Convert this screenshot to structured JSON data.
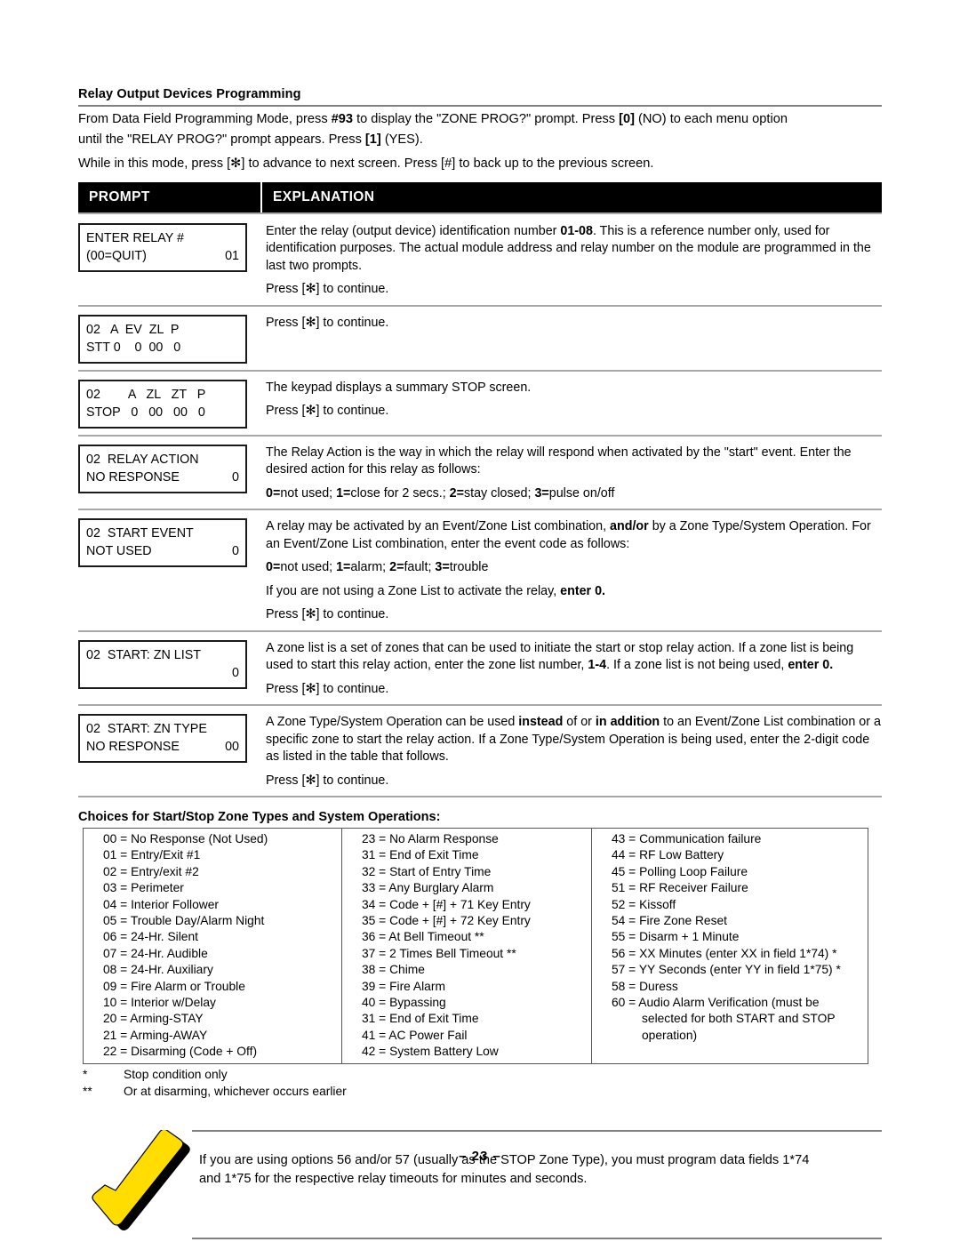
{
  "section": {
    "title": "Relay Output Devices Programming",
    "intro_line1": "From Data Field Programming Mode, press #93 to display the \"ZONE PROG?\" prompt.  Press [0] (NO) to each menu option",
    "intro_line2": "until the \"RELAY PROG?\" prompt appears. Press [1] (YES).",
    "intro_line3": "While in this mode, press [✻] to advance to next screen. Press [#] to back up to the previous screen."
  },
  "table_header": {
    "prompt": "PROMPT",
    "explanation": "EXPLANATION"
  },
  "rows": [
    {
      "keypad": {
        "line1_left": "ENTER RELAY #",
        "line1_right": "",
        "line2_left": "(00=QUIT)",
        "line2_right": "01"
      },
      "explanation": [
        "Enter the relay (output device) identification number 01-08. This is a reference number only, used for identification purposes. The actual module address and relay number on the module are programmed in the last two prompts.",
        "Press [✻] to continue."
      ]
    },
    {
      "keypad": {
        "line1_left": "02   A  EV  ZL  P",
        "line1_right": "",
        "line2_left": "STT 0    0  00   0",
        "line2_right": ""
      },
      "explanation": [
        "Press [✻] to continue."
      ]
    },
    {
      "keypad": {
        "line1_left": "02        A   ZL   ZT   P",
        "line1_right": "",
        "line2_left": "STOP   0   00   00   0",
        "line2_right": ""
      },
      "explanation": [
        "The keypad displays a summary STOP screen.",
        "Press [✻] to continue."
      ]
    },
    {
      "keypad": {
        "line1_left": "02  RELAY ACTION",
        "line1_right": "",
        "line2_left": "NO RESPONSE",
        "line2_right": "0"
      },
      "explanation": [
        "The Relay Action is the way in which the relay will respond when activated by the \"start\" event. Enter the desired action for this relay as follows:",
        "0=not used; 1=close for 2 secs.; 2=stay closed; 3=pulse on/off"
      ]
    },
    {
      "keypad": {
        "line1_left": "02  START EVENT",
        "line1_right": "",
        "line2_left": "NOT USED",
        "line2_right": "0"
      },
      "explanation": [
        "A relay may be activated by an Event/Zone List combination, and/or by a Zone Type/System Operation.  For an Event/Zone List combination, enter the event code as follows:",
        "0=not used; 1=alarm; 2=fault; 3=trouble",
        "If you are not using a Zone List to activate the relay, enter 0.",
        "Press [✻] to continue."
      ]
    },
    {
      "keypad": {
        "line1_left": "02  START: ZN LIST",
        "line1_right": "",
        "line2_left": "",
        "line2_right": "0"
      },
      "explanation": [
        "A zone list is a set of zones that can be used to initiate the start or stop relay action. If a zone list is being used to start this relay action, enter the zone list number, 1-4. If a zone list is not being used, enter 0.",
        "Press [✻] to continue."
      ]
    },
    {
      "keypad": {
        "line1_left": "02  START: ZN TYPE",
        "line1_right": "",
        "line2_left": "NO RESPONSE",
        "line2_right": "00"
      },
      "explanation": [
        "A Zone Type/System Operation can be used instead of or in addition to an Event/Zone List combination or a specific zone to start the relay action.  If a Zone Type/System Operation is being used, enter the 2-digit code as listed in the table that follows.",
        "Press [✻] to continue."
      ]
    }
  ],
  "choices": {
    "title": "Choices for Start/Stop Zone Types and System Operations:",
    "col1": [
      "00 = No Response (Not Used)",
      "01 = Entry/Exit #1",
      "02 = Entry/exit #2",
      "03 = Perimeter",
      "04 = Interior Follower",
      "05 = Trouble Day/Alarm Night",
      "06 = 24-Hr. Silent",
      "07 = 24-Hr. Audible",
      "08 = 24-Hr. Auxiliary",
      "09 = Fire Alarm or Trouble",
      "10 = Interior w/Delay",
      "20 = Arming-STAY",
      "21 = Arming-AWAY",
      "22 = Disarming (Code + Off)"
    ],
    "col2": [
      "23 = No Alarm Response",
      "31 = End of Exit Time",
      "32 = Start of Entry Time",
      "33 = Any Burglary Alarm",
      "34 = Code + [#] + 71 Key Entry",
      "35 = Code + [#] + 72 Key Entry",
      "36 = At Bell Timeout **",
      "37 = 2 Times Bell Timeout **",
      "38 = Chime",
      "39 = Fire Alarm",
      "40 = Bypassing",
      "31 = End of Exit Time",
      "41 = AC Power Fail",
      "42 = System Battery Low"
    ],
    "col3": [
      "43 = Communication failure",
      "44 = RF Low Battery",
      "45 = Polling Loop Failure",
      "51 = RF Receiver Failure",
      "52 = Kissoff",
      "54 = Fire Zone Reset",
      "55 = Disarm + 1 Minute",
      "56 = XX Minutes (enter XX in field 1*74) *",
      "57 = YY Seconds (enter YY in field 1*75) *",
      "58 = Duress",
      "60 = Audio Alarm Verification (must be"
    ],
    "col3_cont": [
      "selected for both START and STOP",
      "operation)"
    ]
  },
  "footnotes": [
    {
      "mark": "*",
      "text": "Stop condition only"
    },
    {
      "mark": "**",
      "text": "Or at disarming, whichever occurs earlier"
    }
  ],
  "note": {
    "icon": "checkmark-icon",
    "accent_color": "#FFDD00",
    "line1": "If you are using options 56 and/or 57 (usually as the STOP Zone Type), you must program data fields 1*74",
    "line2": "and 1*75 for the respective relay timeouts for minutes and seconds."
  },
  "page_number": "– 23 –"
}
